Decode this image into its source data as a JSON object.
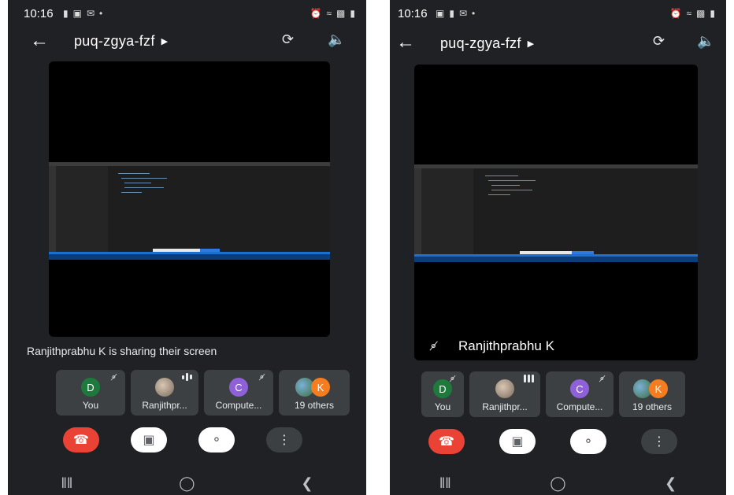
{
  "left": {
    "status": {
      "time": "10:16",
      "left_icons": [
        "message-icon",
        "image-icon",
        "mail-icon",
        "dot-icon"
      ],
      "right_icons": [
        "alarm-icon",
        "wifi-icon",
        "signal-icon",
        "battery-icon"
      ]
    },
    "meeting_code": "puq-zgya-fzf",
    "share_text": "Ranjithprabhu K is sharing their screen",
    "participants": [
      {
        "initial": "D",
        "label": "You",
        "color": "#1e7a3c",
        "muted": true
      },
      {
        "initial": "",
        "label": "Ranjithpr...",
        "photo": true,
        "speaking": true
      },
      {
        "initial": "C",
        "label": "Compute...",
        "color": "#8e61d8",
        "muted": true
      },
      {
        "initial": "K",
        "label": "19 others",
        "group": true
      }
    ]
  },
  "right": {
    "status": {
      "time": "10:16",
      "left_icons": [
        "image-icon",
        "message-icon",
        "mail-icon",
        "dot-icon"
      ],
      "right_icons": [
        "alarm-icon",
        "wifi-icon",
        "signal-icon",
        "battery-icon"
      ]
    },
    "meeting_code": "puq-zgya-fzf",
    "presenter_name": "Ranjithprabhu K",
    "participants": [
      {
        "initial": "D",
        "label": "You",
        "color": "#1e7a3c",
        "muted": true
      },
      {
        "initial": "",
        "label": "Ranjithpr...",
        "photo": true,
        "speaking": true
      },
      {
        "initial": "C",
        "label": "Compute...",
        "color": "#8e61d8",
        "muted": true
      },
      {
        "initial": "K",
        "label": "19 others",
        "group": true
      }
    ]
  },
  "colors": {
    "background": "#202124",
    "end_call": "#ea4335",
    "tile": "#3c4043"
  }
}
